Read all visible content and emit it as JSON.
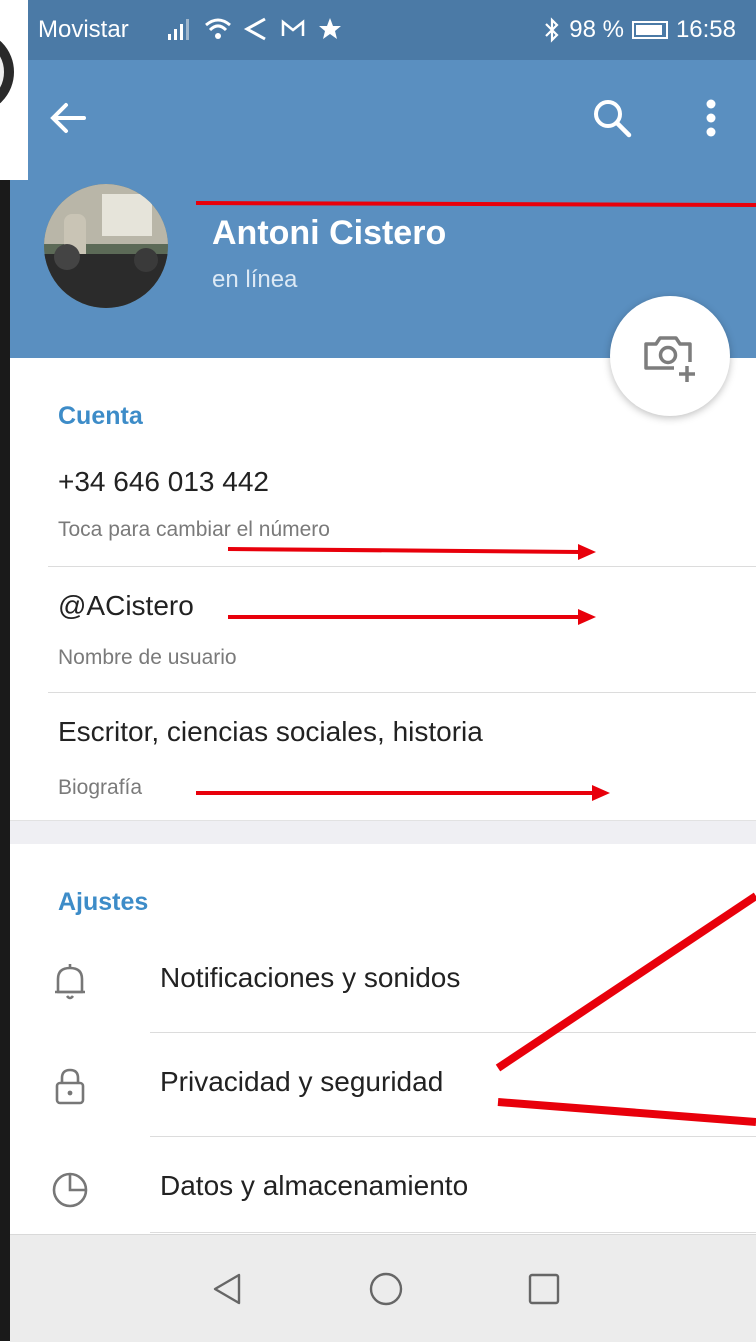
{
  "status_bar": {
    "carrier": "Movistar",
    "icons": [
      "signal-icon",
      "wifi-icon",
      "location-icon",
      "gmail-icon",
      "star-icon"
    ],
    "bluetooth_icon": "bluetooth-icon",
    "battery": "98 %",
    "time": "16:58"
  },
  "app_bar": {
    "back_icon": "←",
    "actions": [
      "search-icon",
      "more-vert-icon"
    ]
  },
  "profile": {
    "name": "Antoni Cistero",
    "status": "en línea",
    "camera_icon": "camera-add-icon"
  },
  "account": {
    "header": "Cuenta",
    "phone": "+34 646 013 442",
    "phone_hint": "Toca para cambiar el número",
    "username": "@ACistero",
    "username_hint": "Nombre de usuario",
    "bio": "Escritor, ciencias sociales, historia",
    "bio_hint": "Biografía"
  },
  "settings": {
    "header": "Ajustes",
    "items": [
      {
        "label": "Notificaciones y sonidos",
        "icon": "bell-icon"
      },
      {
        "label": "Privacidad y seguridad",
        "icon": "lock-icon"
      },
      {
        "label": "Datos y almacenamiento",
        "icon": "pie-chart-icon"
      }
    ]
  },
  "nav_bar": {
    "buttons": [
      "back-triangle-icon",
      "home-circle-icon",
      "recents-square-icon"
    ]
  },
  "colors": {
    "header_blue": "#5a8fc0",
    "status_blue": "#4b7aa6",
    "accent_blue": "#3d8cc8",
    "annotation_red": "#e8000b"
  }
}
